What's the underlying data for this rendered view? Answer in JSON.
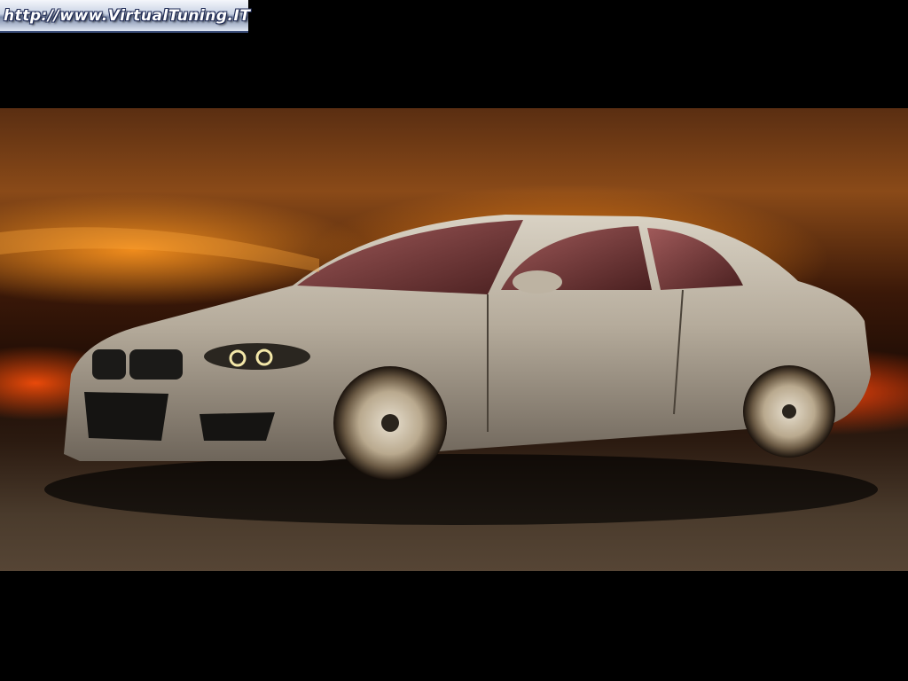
{
  "watermark": {
    "text": "http://www.VirtualTuning.IT"
  },
  "photo": {
    "subject": "car-coupe",
    "colors": {
      "body": "#b7ae9f",
      "glow": "#ff8a1a",
      "window": "#7a3a3a"
    }
  }
}
